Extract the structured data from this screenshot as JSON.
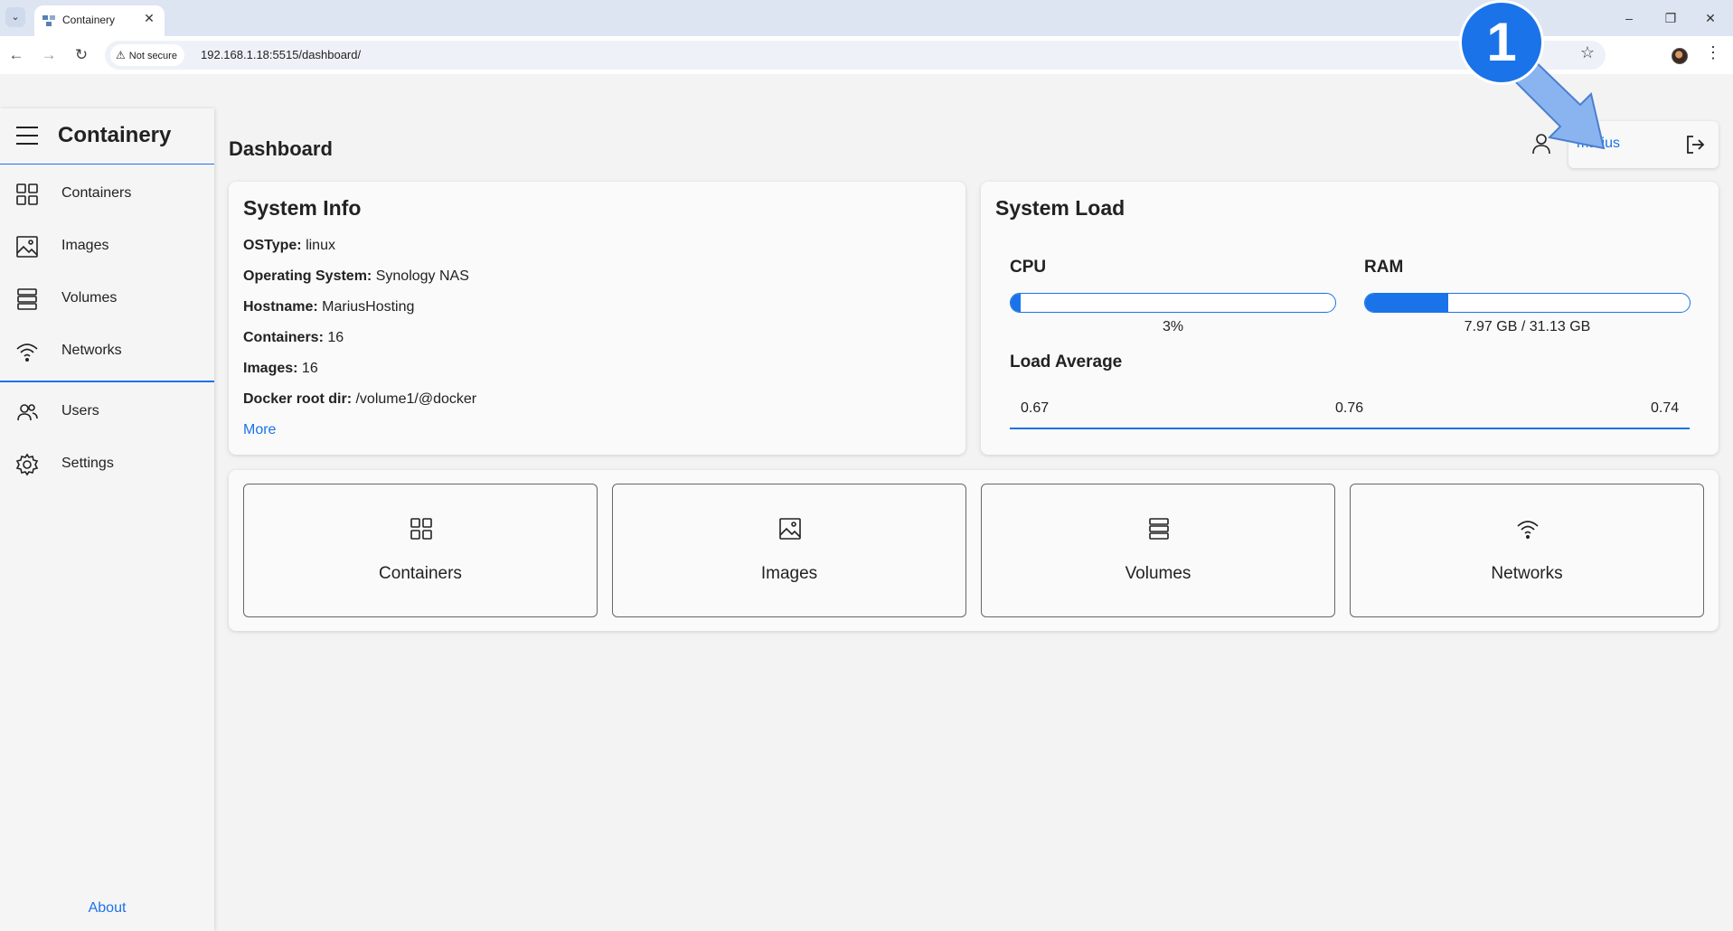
{
  "browser": {
    "tab_title": "Containery",
    "not_secure_label": "Not secure",
    "url": "192.168.1.18:5515/dashboard/",
    "minimize": "–",
    "restore": "❐",
    "close": "✕",
    "tab_close": "✕"
  },
  "sidebar": {
    "app_name": "Containery",
    "items": [
      {
        "label": "Containers",
        "icon": "grid-icon"
      },
      {
        "label": "Images",
        "icon": "image-icon"
      },
      {
        "label": "Volumes",
        "icon": "stack-icon"
      },
      {
        "label": "Networks",
        "icon": "wifi-icon"
      },
      {
        "label": "Users",
        "icon": "users-icon"
      },
      {
        "label": "Settings",
        "icon": "gear-icon"
      }
    ],
    "about_label": "About"
  },
  "header": {
    "title": "Dashboard",
    "username": "marius"
  },
  "system_info": {
    "title": "System Info",
    "rows": [
      {
        "label": "OSType:",
        "value": "linux"
      },
      {
        "label": "Operating System:",
        "value": "Synology NAS"
      },
      {
        "label": "Hostname:",
        "value": "MariusHosting"
      },
      {
        "label": "Containers:",
        "value": "16"
      },
      {
        "label": "Images:",
        "value": "16"
      },
      {
        "label": "Docker root dir:",
        "value": "/volume1/@docker"
      }
    ],
    "more_label": "More"
  },
  "system_load": {
    "title": "System Load",
    "cpu": {
      "label": "CPU",
      "caption": "3%",
      "fraction": 0.03
    },
    "ram": {
      "label": "RAM",
      "caption": "7.97 GB / 31.13 GB",
      "fraction": 0.256
    },
    "load_average": {
      "label": "Load Average",
      "values": [
        "0.67",
        "0.76",
        "0.74"
      ]
    }
  },
  "tiles": [
    {
      "label": "Containers",
      "icon": "grid-icon"
    },
    {
      "label": "Images",
      "icon": "image-icon"
    },
    {
      "label": "Volumes",
      "icon": "stack-icon"
    },
    {
      "label": "Networks",
      "icon": "wifi-icon"
    }
  ],
  "overlay": {
    "step_number": "1"
  },
  "colors": {
    "accent": "#1a73e8"
  }
}
